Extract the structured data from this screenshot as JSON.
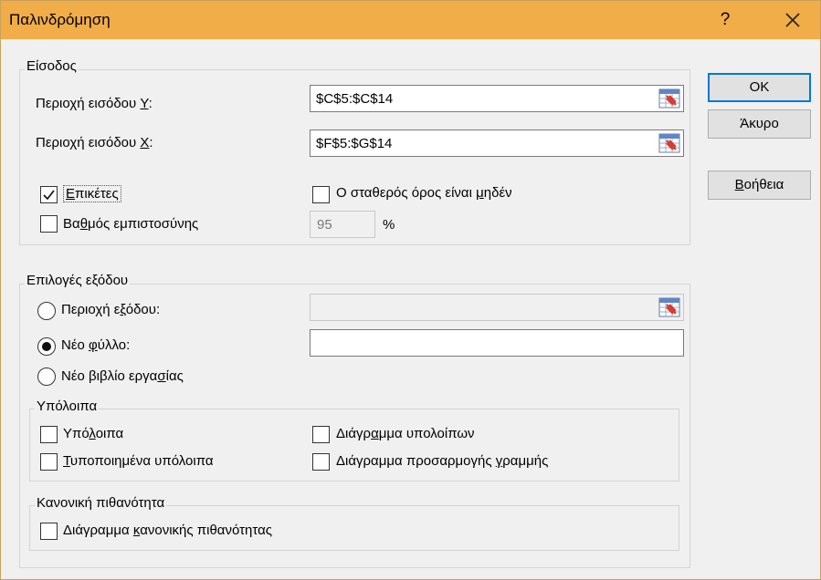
{
  "window": {
    "title": "Παλινδρόμηση",
    "help_label": "?",
    "close_icon": "close-icon"
  },
  "input_group": {
    "label": "Είσοδος",
    "y_range": {
      "label_pre": "Περιοχή εισόδου ",
      "label_key": "Y",
      "label_post": ":",
      "value": "$C$5:$C$14"
    },
    "x_range": {
      "label_pre": "Περιοχή εισόδου ",
      "label_key": "X",
      "label_post": ":",
      "value": "$F$5:$G$14"
    },
    "labels_checkbox": {
      "key": "Ε",
      "rest": "πικέτες",
      "checked": true
    },
    "constant_zero": {
      "pre": "Ο σταθερός όρος είναι ",
      "key": "μ",
      "post": "ηδέν",
      "checked": false
    },
    "confidence": {
      "pre": "Βα",
      "key": "θ",
      "post": "μός εμπιστοσύνης",
      "checked": false,
      "value": "95",
      "unit": "%"
    }
  },
  "output_group": {
    "label": "Επιλογές εξόδου",
    "output_range": {
      "pre": "Περιοχή ε",
      "key": "ξ",
      "post": "όδου:",
      "selected": false,
      "value": ""
    },
    "new_sheet": {
      "pre": "Νέο ",
      "key": "φ",
      "post": "ύλλο:",
      "selected": true,
      "value": ""
    },
    "new_workbook": {
      "pre": "Νέο βιβλίο εργα",
      "key": "σ",
      "post": "ίας",
      "selected": false
    }
  },
  "residuals_group": {
    "label": "Υπόλοιπα",
    "residuals": {
      "pre": "Υπό",
      "key": "λ",
      "post": "οιπα",
      "checked": false
    },
    "standardized": {
      "pre": "",
      "key": "Τ",
      "post": "υποποιημένα υπόλοιπα",
      "checked": false
    },
    "residual_plots": {
      "pre": "Διάγρ",
      "key": "α",
      "post": "μμα υπολοίπων",
      "checked": false
    },
    "line_fit": {
      "pre": "Διάγραμμα προσαρμογής ",
      "key": "γ",
      "post": "ραμμής",
      "checked": false
    }
  },
  "normal_group": {
    "label": "Κανονική πιθανότητα",
    "normal_plot": {
      "pre": "Διάγραμμα ",
      "key": "κ",
      "post": "ανονικής πιθανότητας",
      "checked": false
    }
  },
  "buttons": {
    "ok": "OK",
    "cancel": "Άκυρο",
    "help_pre": "",
    "help_key": "Β",
    "help_post": "οήθεια"
  },
  "colors": {
    "titlebar": "#f1ad47",
    "dialog_bg": "#f0f0f0",
    "focus": "#0078d7"
  }
}
